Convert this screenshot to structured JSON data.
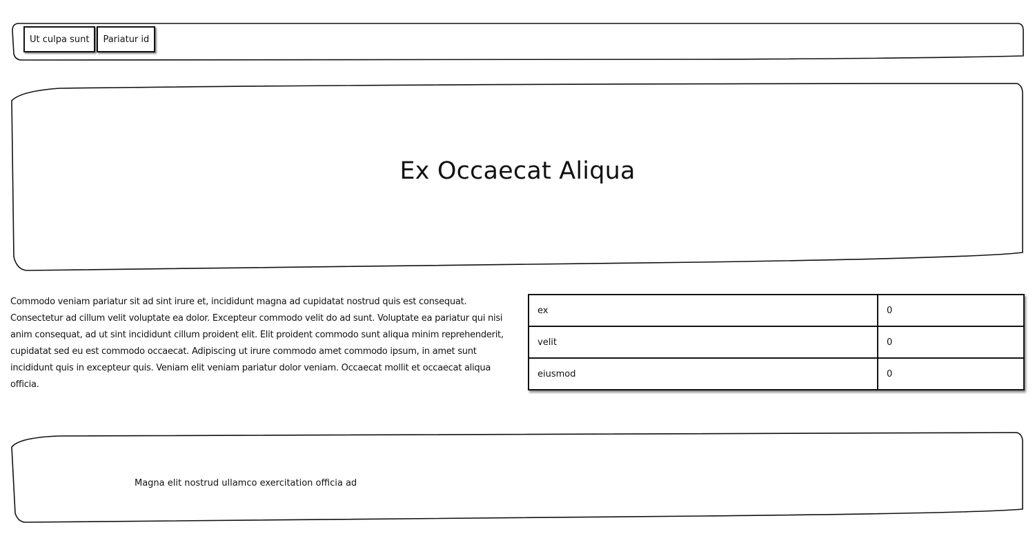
{
  "nav": {
    "tabs": [
      {
        "label": "Ut culpa sunt"
      },
      {
        "label": "Pariatur id"
      }
    ]
  },
  "hero": {
    "title": "Ex Occaecat Aliqua"
  },
  "content": {
    "paragraph": "Commodo veniam pariatur sit ad sint irure et, incididunt magna ad cupidatat nostrud quis est consequat. Consectetur ad cillum velit voluptate ea dolor. Excepteur commodo velit do ad sunt. Voluptate ea pariatur qui nisi anim consequat, ad ut sint incididunt cillum proident elit. Elit proident commodo sunt aliqua minim reprehenderit, cupidatat sed eu est commodo occaecat. Adipiscing ut irure commodo amet commodo ipsum, in amet sunt incididunt quis in excepteur quis. Veniam elit veniam pariatur dolor veniam. Occaecat mollit et occaecat aliqua officia."
  },
  "table": {
    "rows": [
      {
        "key": "ex",
        "value": "0"
      },
      {
        "key": "velit",
        "value": "0"
      },
      {
        "key": "eiusmod",
        "value": "0"
      }
    ]
  },
  "footer": {
    "text": "Magna elit nostrud ullamco exercitation officia ad"
  }
}
